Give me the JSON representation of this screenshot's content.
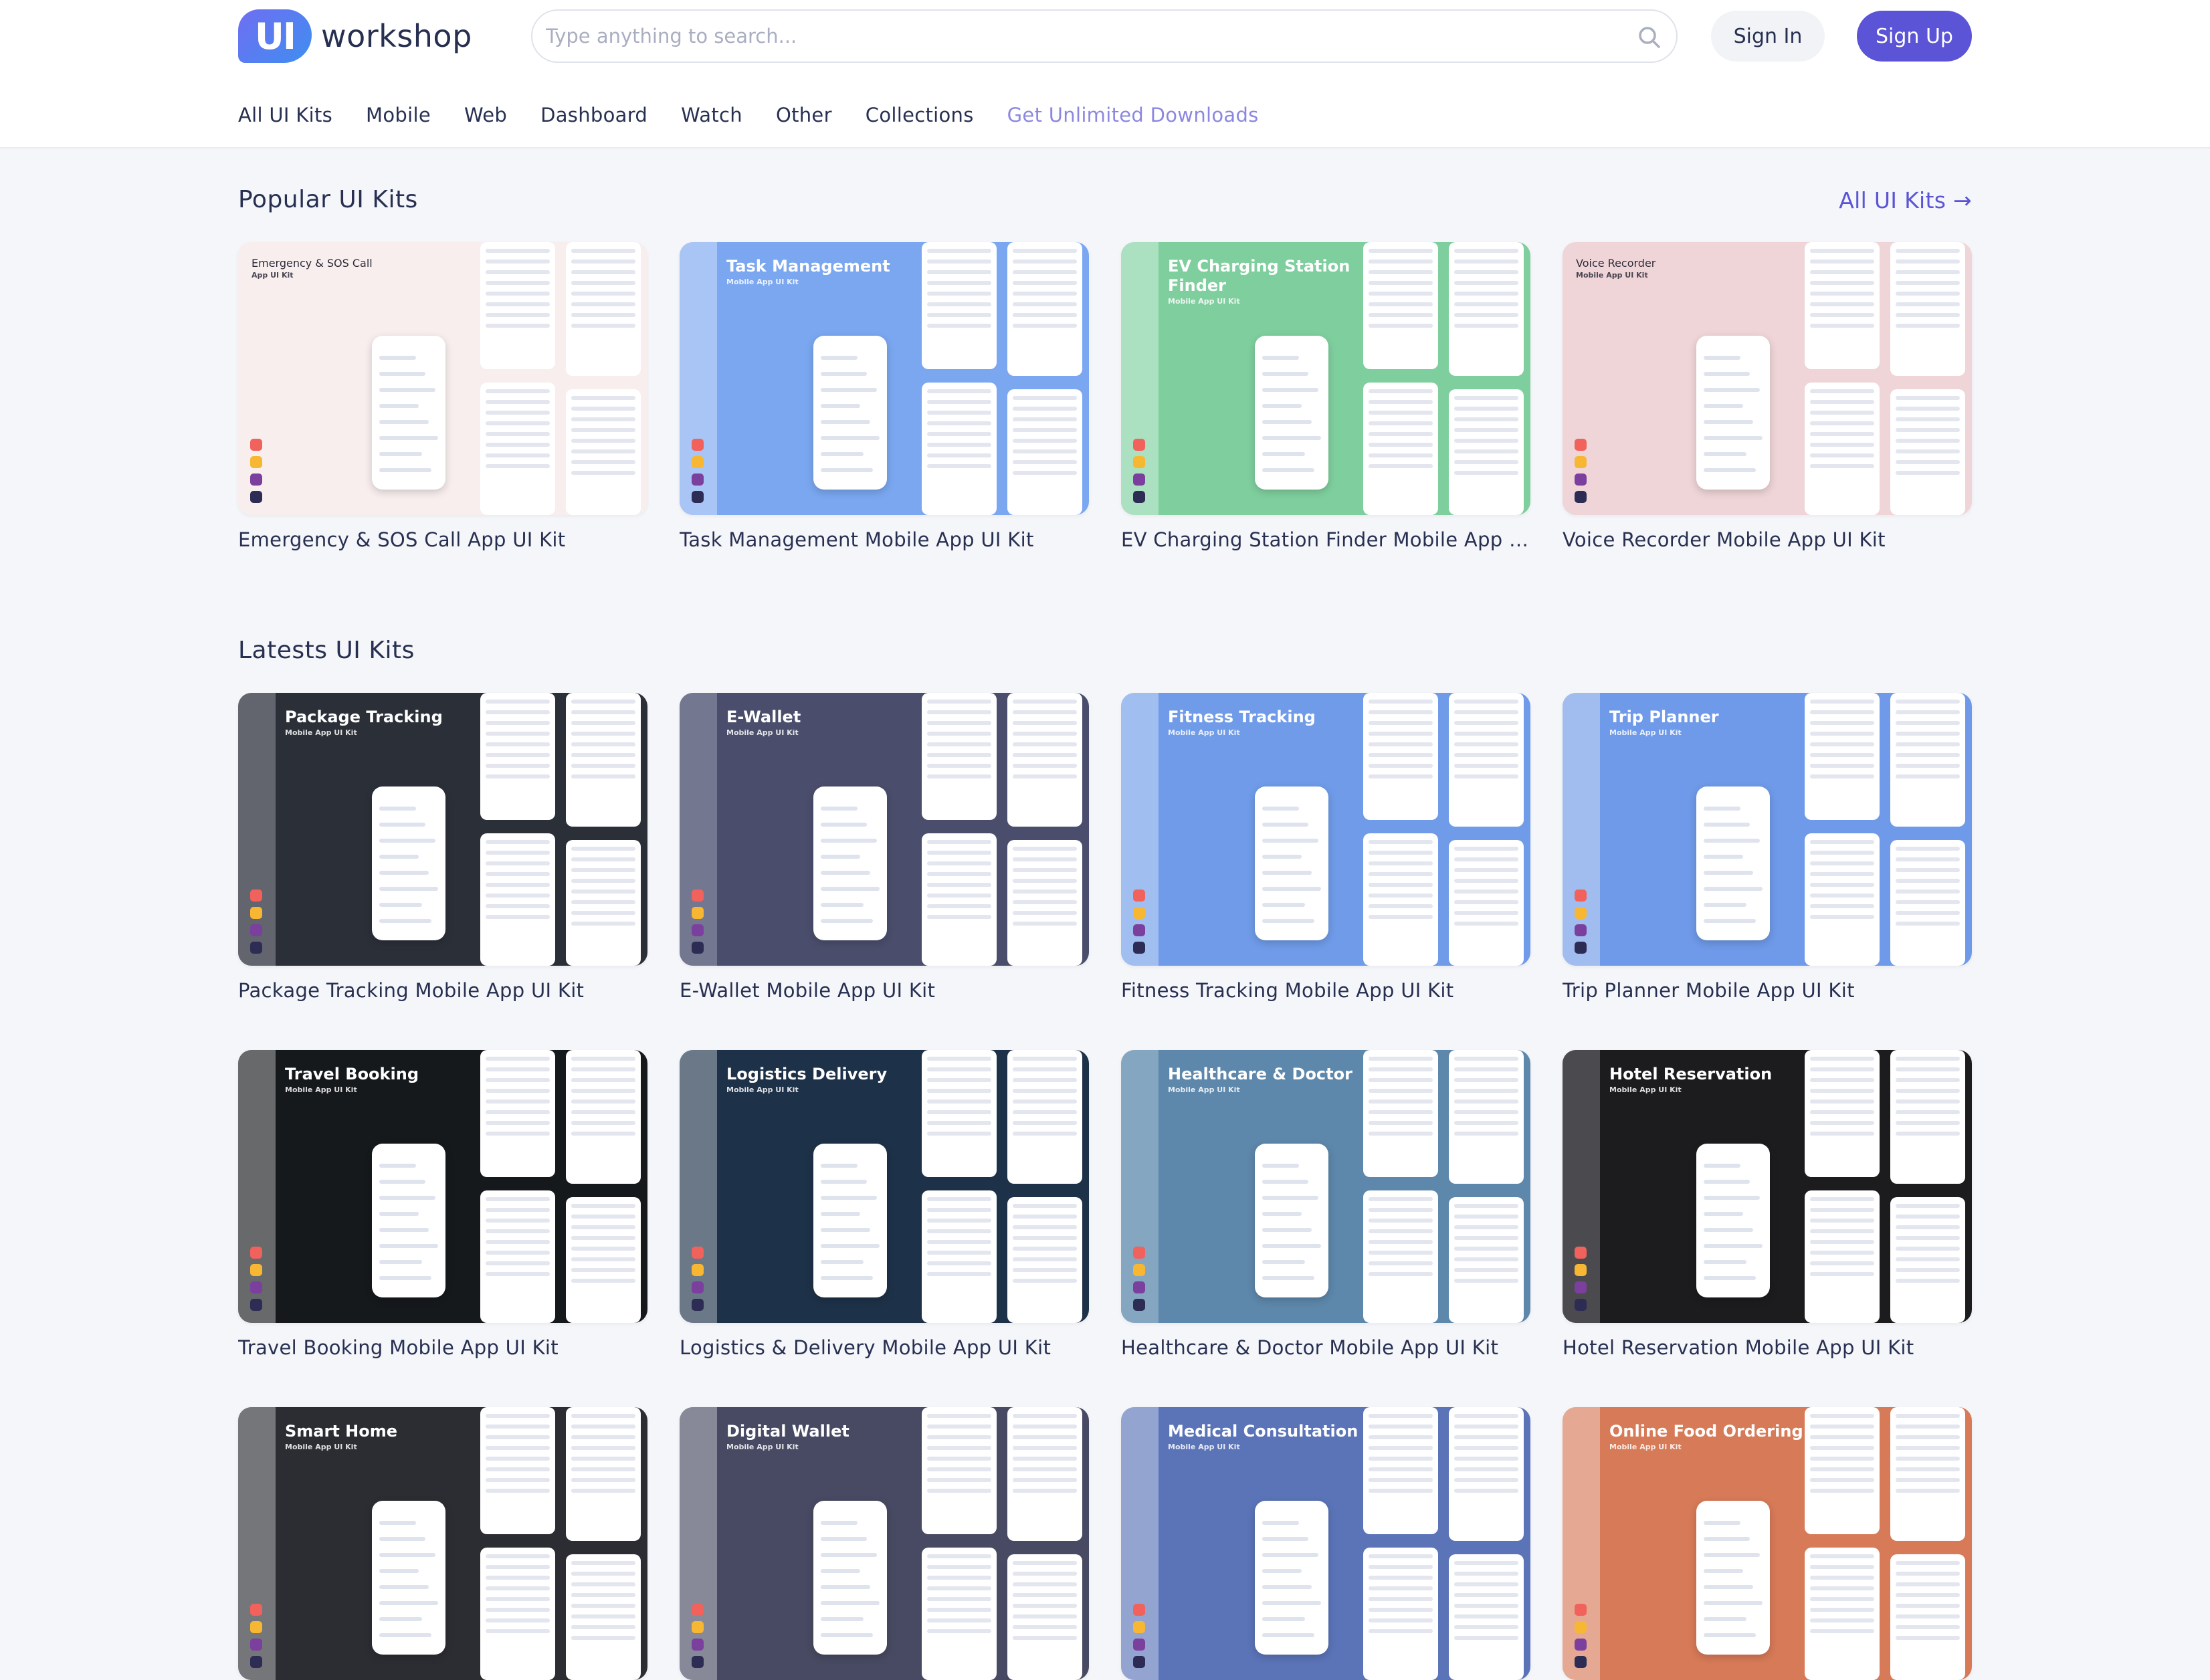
{
  "header": {
    "logo_mark": "UI",
    "logo_word": "workshop",
    "search_placeholder": "Type anything to search...",
    "sign_in": "Sign In",
    "sign_up": "Sign Up"
  },
  "nav": [
    {
      "label": "All UI Kits"
    },
    {
      "label": "Mobile"
    },
    {
      "label": "Web"
    },
    {
      "label": "Dashboard"
    },
    {
      "label": "Watch"
    },
    {
      "label": "Other"
    },
    {
      "label": "Collections"
    },
    {
      "label": "Get Unlimited Downloads"
    }
  ],
  "popular": {
    "title": "Popular UI Kits",
    "all_link": "All UI Kits →",
    "cards": [
      {
        "thumb_title": "Emergency & SOS Call",
        "thumb_sub": "App UI Kit",
        "title": "Emergency & SOS Call App UI Kit",
        "bg": "#f8eeee",
        "accent": "#e15656"
      },
      {
        "thumb_title": "Task Management",
        "thumb_sub": "Mobile App UI Kit",
        "title": "Task Management Mobile App UI Kit",
        "bg": "#7aa7f0",
        "accent": "#ffffff"
      },
      {
        "thumb_title": "EV Charging Station Finder",
        "thumb_sub": "Mobile App UI Kit",
        "title": "EV Charging Station Finder Mobile App UI Kit",
        "bg": "#7fcf9e",
        "accent": "#ffffff"
      },
      {
        "thumb_title": "Voice Recorder",
        "thumb_sub": "Mobile App UI Kit",
        "title": "Voice Recorder Mobile App UI Kit",
        "bg": "#efd5d8",
        "accent": "#d84f4f"
      }
    ]
  },
  "latest": {
    "title": "Latests UI Kits",
    "cards": [
      {
        "thumb_title": "Package Tracking",
        "thumb_sub": "Mobile App UI Kit",
        "title": "Package Tracking Mobile App UI Kit",
        "bg": "#2b2f38",
        "accent": "#c8ccd2"
      },
      {
        "thumb_title": "E-Wallet",
        "thumb_sub": "Mobile App UI Kit",
        "title": "E-Wallet Mobile App UI Kit",
        "bg": "#4a4e6c",
        "accent": "#c4c5d3"
      },
      {
        "thumb_title": "Fitness Tracking",
        "thumb_sub": "Mobile App UI Kit",
        "title": "Fitness Tracking Mobile App UI Kit",
        "bg": "#6f9be8",
        "accent": "#ffffff"
      },
      {
        "thumb_title": "Trip Planner",
        "thumb_sub": "Mobile App UI Kit",
        "title": "Trip Planner Mobile App UI Kit",
        "bg": "#6f9ae9",
        "accent": "#ffffff"
      },
      {
        "thumb_title": "Travel Booking",
        "thumb_sub": "Mobile App UI Kit",
        "title": "Travel Booking Mobile App UI Kit",
        "bg": "#16191c",
        "accent": "#ffffff"
      },
      {
        "thumb_title": "Logistics Delivery",
        "thumb_sub": "Mobile App UI Kit",
        "title": "Logistics & Delivery Mobile App UI Kit",
        "bg": "#1d3148",
        "accent": "#ffffff"
      },
      {
        "thumb_title": "Healthcare & Doctor",
        "thumb_sub": "Mobile App UI Kit",
        "title": "Healthcare & Doctor Mobile App UI Kit",
        "bg": "#5d87ab",
        "accent": "#cfe0e8"
      },
      {
        "thumb_title": "Hotel Reservation",
        "thumb_sub": "Mobile App UI Kit",
        "title": "Hotel Reservation Mobile App UI Kit",
        "bg": "#1c1c1f",
        "accent": "#a4a4a8"
      },
      {
        "thumb_title": "Smart Home",
        "thumb_sub": "Mobile App UI Kit",
        "title": "",
        "bg": "#2b2d33",
        "accent": "#ffffff"
      },
      {
        "thumb_title": "Digital Wallet",
        "thumb_sub": "Mobile App UI Kit",
        "title": "",
        "bg": "#474a62",
        "accent": "#ffffff"
      },
      {
        "thumb_title": "Medical Consultation",
        "thumb_sub": "Mobile App UI Kit",
        "title": "",
        "bg": "#5b74b8",
        "accent": "#ffffff"
      },
      {
        "thumb_title": "Online Food Ordering",
        "thumb_sub": "Mobile App UI Kit",
        "title": "",
        "bg": "#d77a58",
        "accent": "#ffffff"
      }
    ]
  },
  "tool_colors": [
    "#f0625b",
    "#f7b733",
    "#7b3f9e",
    "#2c2c54"
  ]
}
